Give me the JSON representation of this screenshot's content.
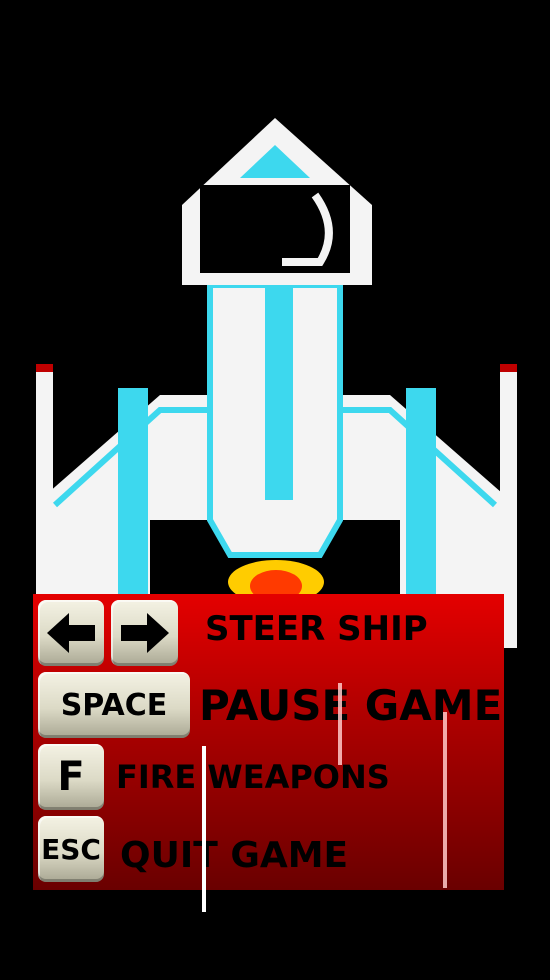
{
  "controls": [
    {
      "keys": [
        "left-arrow",
        "right-arrow"
      ],
      "label": "STEER SHIP"
    },
    {
      "keys": [
        "SPACE"
      ],
      "label": "PAUSE GAME"
    },
    {
      "keys": [
        "F"
      ],
      "label": "FIRE WEAPONS"
    },
    {
      "keys": [
        "ESC"
      ],
      "label": "QUIT GAME"
    }
  ],
  "colors": {
    "background": "#000000",
    "panel_top": "#e40000",
    "panel_bottom": "#6a0000",
    "ship_body": "#ffffff",
    "ship_accent": "#3dd8ee",
    "thruster": "#ffcc00"
  }
}
